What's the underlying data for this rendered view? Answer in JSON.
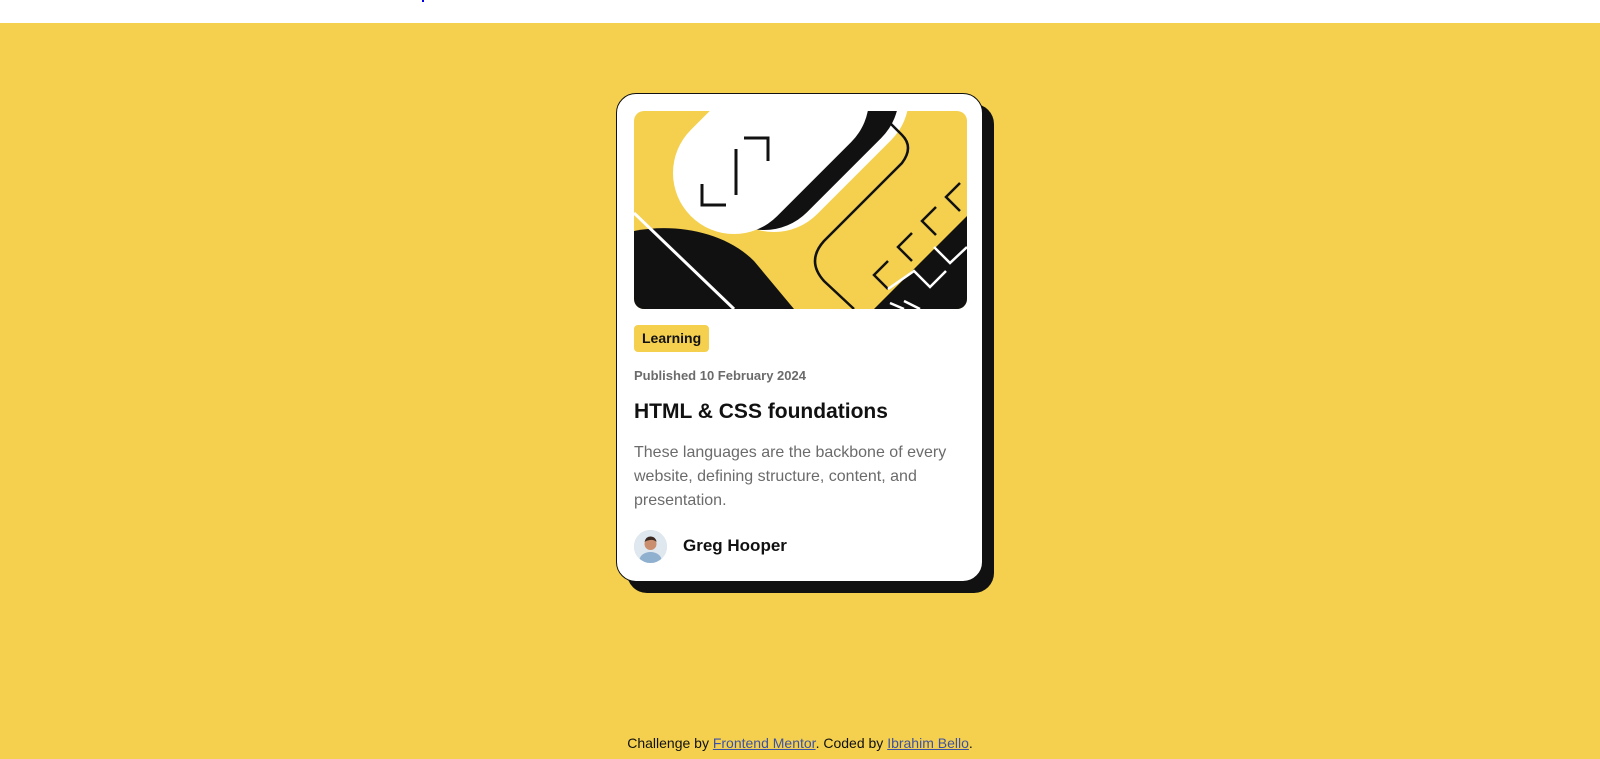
{
  "card": {
    "tag": "Learning",
    "published": "Published 10 February 2024",
    "title": "HTML & CSS foundations",
    "description": "These languages are the backbone of every website, defining structure, content, and presentation.",
    "author": "Greg Hooper"
  },
  "footer": {
    "prefix": "Challenge by ",
    "link1": "Frontend Mentor",
    "middle": ". Coded by ",
    "link2": "Ibrahim Bello",
    "suffix": "."
  },
  "colors": {
    "background": "#f4d04e",
    "card": "#ffffff",
    "ink": "#111111",
    "muted": "#6b6b6b",
    "link": "#3e52a3"
  }
}
